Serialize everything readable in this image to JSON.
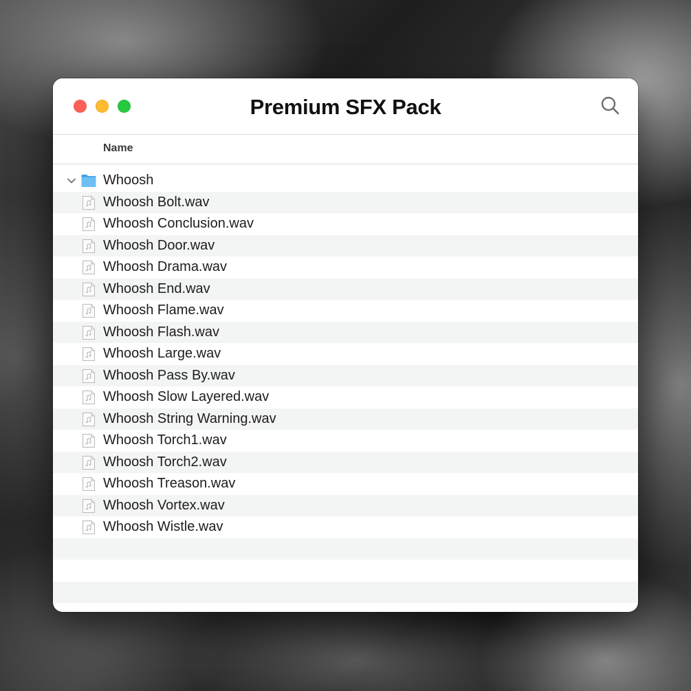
{
  "window": {
    "title": "Premium SFX Pack"
  },
  "columns": {
    "name": "Name"
  },
  "folder": {
    "name": "Whoosh",
    "expanded": true,
    "icon": "folder-icon"
  },
  "files": [
    "Whoosh Bolt.wav",
    "Whoosh Conclusion.wav",
    "Whoosh Door.wav",
    "Whoosh Drama.wav",
    "Whoosh End.wav",
    "Whoosh Flame.wav",
    "Whoosh Flash.wav",
    "Whoosh Large.wav",
    "Whoosh Pass By.wav",
    "Whoosh Slow Layered.wav",
    "Whoosh String Warning.wav",
    "Whoosh Torch1.wav",
    "Whoosh Torch2.wav",
    "Whoosh Treason.wav",
    "Whoosh Vortex.wav",
    "Whoosh Wistle.wav"
  ],
  "colors": {
    "close": "#ff5f57",
    "minimize": "#febc2e",
    "maximize": "#28c840",
    "folder": "#5ab3ec",
    "row_alt": "#f3f4f4"
  }
}
